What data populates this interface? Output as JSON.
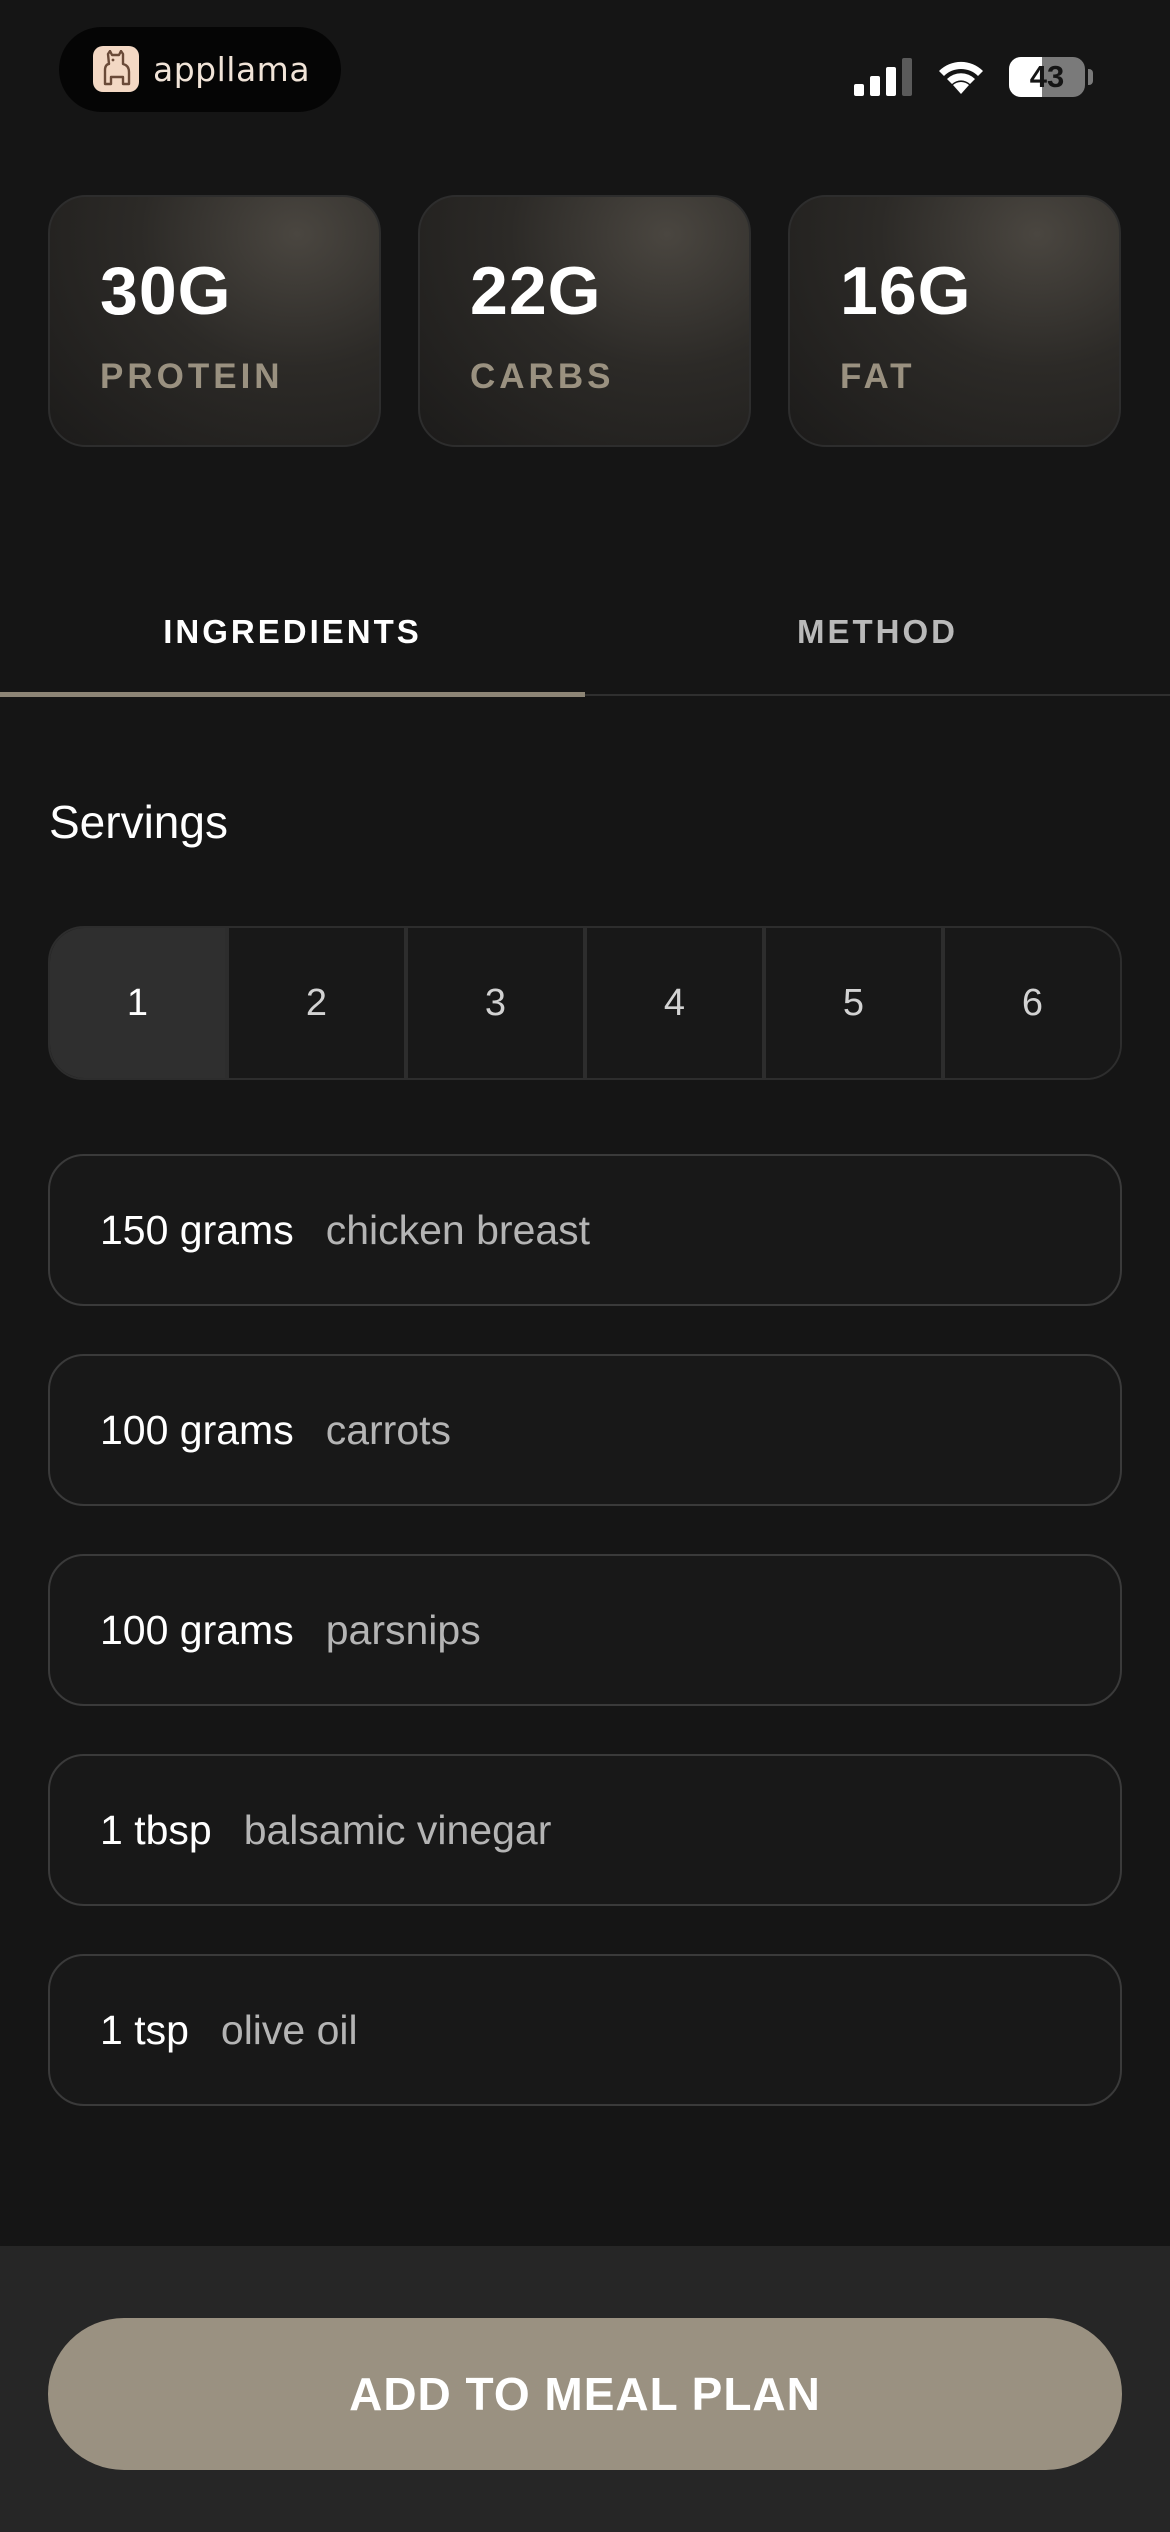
{
  "status_bar": {
    "brand_name": "appllama",
    "brand_icon": "llama-icon",
    "signal_icon": "cellular-signal-icon",
    "wifi_icon": "wifi-icon",
    "battery_level": "43",
    "battery_fraction": 0.43
  },
  "macros": [
    {
      "value": "30G",
      "label": "PROTEIN"
    },
    {
      "value": "22G",
      "label": "CARBS"
    },
    {
      "value": "16G",
      "label": "FAT"
    }
  ],
  "tabs": {
    "ingredients": "INGREDIENTS",
    "method": "METHOD",
    "active": "INGREDIENTS"
  },
  "servings": {
    "title": "Servings",
    "options": [
      "1",
      "2",
      "3",
      "4",
      "5",
      "6"
    ],
    "selected": "1"
  },
  "ingredients": [
    {
      "qty": "150 grams",
      "name": "chicken breast"
    },
    {
      "qty": "100 grams",
      "name": "carrots"
    },
    {
      "qty": "100 grams",
      "name": "parsnips"
    },
    {
      "qty": "1 tbsp",
      "name": "balsamic vinegar"
    },
    {
      "qty": "1 tsp",
      "name": "olive oil"
    }
  ],
  "cta": {
    "label": "ADD TO MEAL PLAN"
  },
  "colors": {
    "background": "#151515",
    "accent": "#9a9181",
    "tab_indicator": "#8d8576",
    "macro_label": "#9a9180"
  }
}
